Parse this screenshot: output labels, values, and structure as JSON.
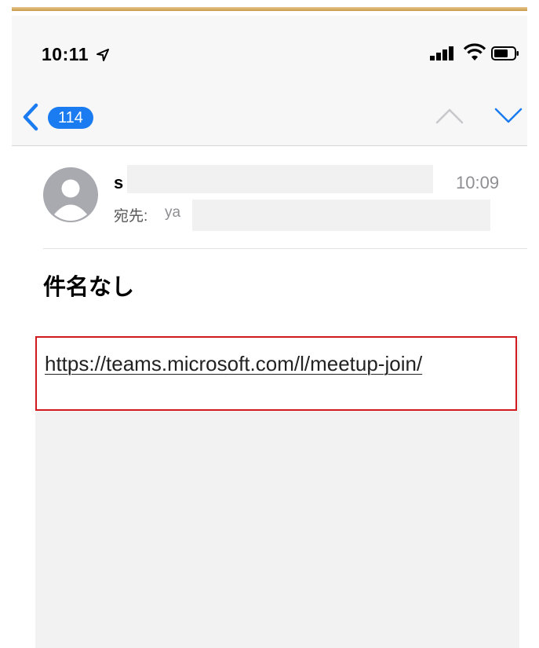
{
  "status_bar": {
    "time": "10:11",
    "icons": [
      "location-arrow-icon",
      "cellular-signal-icon",
      "wifi-icon",
      "battery-icon"
    ]
  },
  "nav": {
    "back_badge": "114",
    "icons": [
      "chevron-left-icon",
      "chevron-up-icon",
      "chevron-down-icon"
    ]
  },
  "message": {
    "sender": "s",
    "time": "10:09",
    "to_label": "宛先:",
    "to_value": "ya",
    "subject": "件名なし",
    "link": "https://teams.microsoft.com/l/meetup-join/"
  },
  "colors": {
    "accent": "#1a7cf0",
    "highlight_box": "#d2191e",
    "secondary_text": "#8e8e93",
    "nav_background": "#f7f7f7",
    "body_background": "#f2f2f2"
  }
}
